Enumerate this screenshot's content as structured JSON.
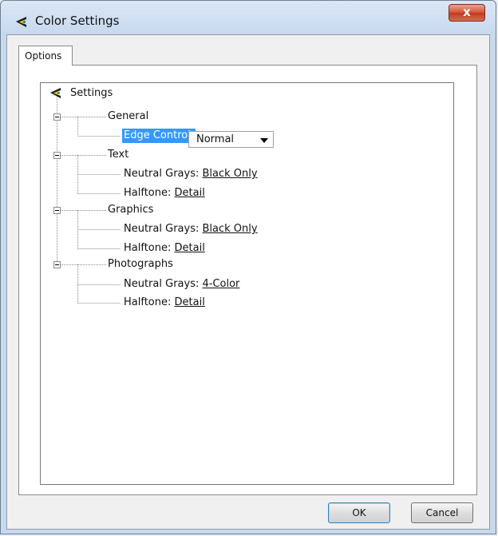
{
  "window": {
    "title": "Color Settings",
    "close_glyph": "x"
  },
  "tabs": [
    {
      "label": "Options"
    }
  ],
  "tree": {
    "root": {
      "label": "Settings",
      "icon": "app-logo-icon"
    },
    "general": {
      "label": "General",
      "edge_control": {
        "label": "Edge Control:",
        "value": "Normal"
      }
    },
    "text": {
      "label": "Text",
      "neutral_grays": {
        "label": "Neutral Grays:",
        "value": "Black Only"
      },
      "halftone": {
        "label": "Halftone:",
        "value": "Detail"
      }
    },
    "graphics": {
      "label": "Graphics",
      "neutral_grays": {
        "label": "Neutral Grays:",
        "value": "Black Only"
      },
      "halftone": {
        "label": "Halftone:",
        "value": "Detail"
      }
    },
    "photographs": {
      "label": "Photographs",
      "neutral_grays": {
        "label": "Neutral Grays:",
        "value": "4-Color"
      },
      "halftone": {
        "label": "Halftone:",
        "value": "Detail"
      }
    }
  },
  "buttons": {
    "ok": "OK",
    "cancel": "Cancel"
  },
  "colors": {
    "selection": "#3399ff",
    "title_bar": "#c8d9ee",
    "close_button": "#c0391e"
  }
}
